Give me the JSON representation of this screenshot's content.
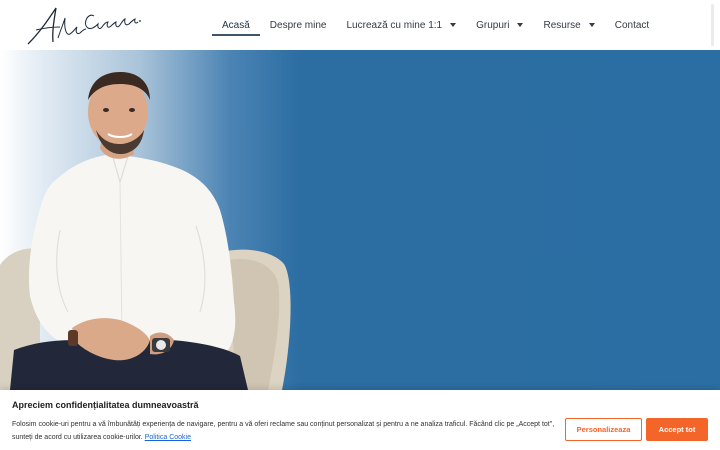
{
  "brand": {
    "logo_text": "Alex Caciulau."
  },
  "nav": {
    "items": [
      {
        "label": "Acasă",
        "active": true,
        "dropdown": false
      },
      {
        "label": "Despre mine",
        "active": false,
        "dropdown": false
      },
      {
        "label": "Lucrează cu mine 1:1",
        "active": false,
        "dropdown": true
      },
      {
        "label": "Grupuri",
        "active": false,
        "dropdown": true
      },
      {
        "label": "Resurse",
        "active": false,
        "dropdown": true
      },
      {
        "label": "Contact",
        "active": false,
        "dropdown": false
      }
    ]
  },
  "cookie_banner": {
    "title": "Apreciem confidențialitatea dumneavoastră",
    "text": "Folosim cookie-uri pentru a vă îmbunătăți experiența de navigare, pentru a vă oferi reclame sau conținut personalizat și pentru a ne analiza traficul. Făcând clic pe „Accept tot\", sunteți de acord cu utilizarea cookie-urilor.",
    "link_label": "Politica Cookie",
    "customize_label": "Personalizeaza",
    "accept_label": "Accept tot"
  },
  "colors": {
    "hero_blue": "#2b6ea3",
    "accent_orange": "#f4652a",
    "link_blue": "#1863dc",
    "nav_text": "#333a44"
  }
}
